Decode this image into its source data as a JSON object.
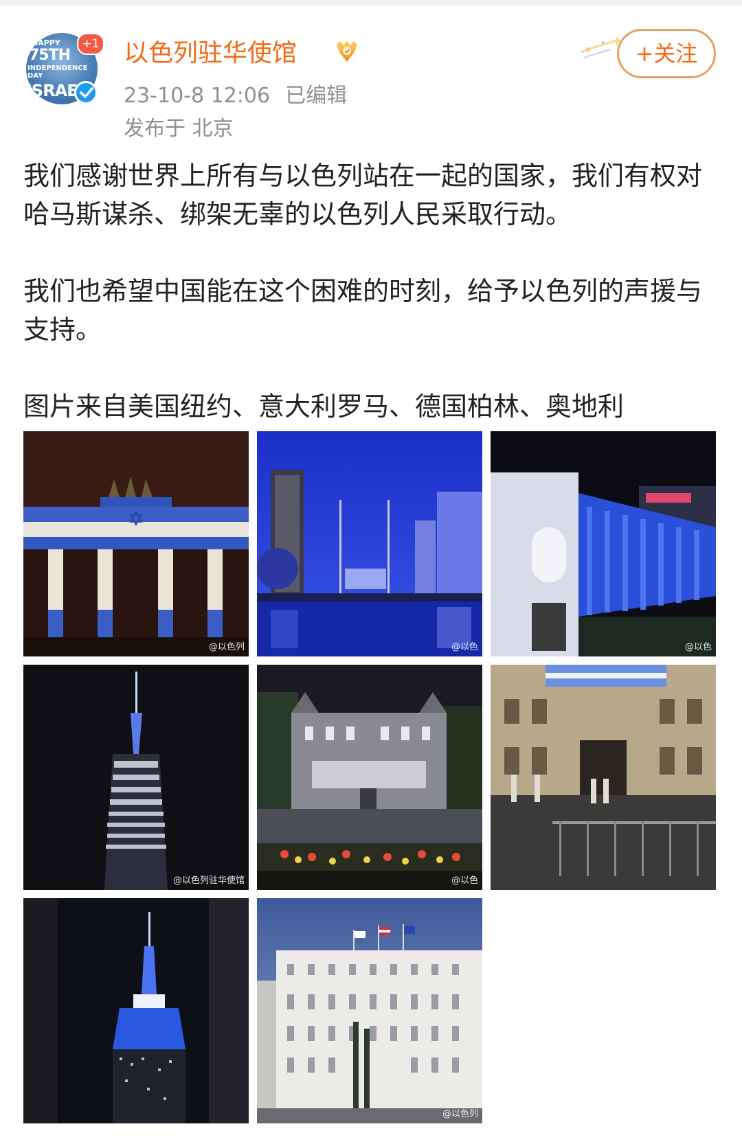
{
  "post": {
    "author": {
      "name": "以色列驻华使馆",
      "avatar_text": [
        "HAPPY",
        "75TH",
        "INDEPENDENCE DAY",
        "ISRAEL"
      ],
      "avatar_badge": "+1",
      "verified": true,
      "accent_color": "#f36a16"
    },
    "timestamp": "23-10-8 12:06",
    "edited_label": "已编辑",
    "location": "发布于 北京",
    "follow_button": "+关注",
    "paragraphs": [
      "我们感谢世界上所有与以色列站在一起的国家，我们有权对哈马斯谋杀、绑架无辜的以色列人民采取行动。",
      "我们也希望中国能在这个困难的时刻，给予以色列的声援与支持。",
      "图片来自美国纽约、意大利罗马、德国柏林、奥地利"
    ],
    "photos": [
      {
        "subject": "Brandenburg Gate lit in blue and white",
        "watermark": "@以色列"
      },
      {
        "subject": "Albany skyline at night lit in blue",
        "watermark": "@以色"
      },
      {
        "subject": "Colonnade building lit in blue",
        "watermark": "@以色"
      },
      {
        "subject": "One World Trade Center spire lit blue",
        "watermark": "@以色列驻华使馆"
      },
      {
        "subject": "New York State Capitol at night",
        "watermark": "@以色"
      },
      {
        "subject": "Rome palazzo with projection",
        "watermark": ""
      },
      {
        "subject": "Empire State Building lit blue and white",
        "watermark": ""
      },
      {
        "subject": "Vienna building with flags",
        "watermark": "@以色列"
      }
    ]
  }
}
